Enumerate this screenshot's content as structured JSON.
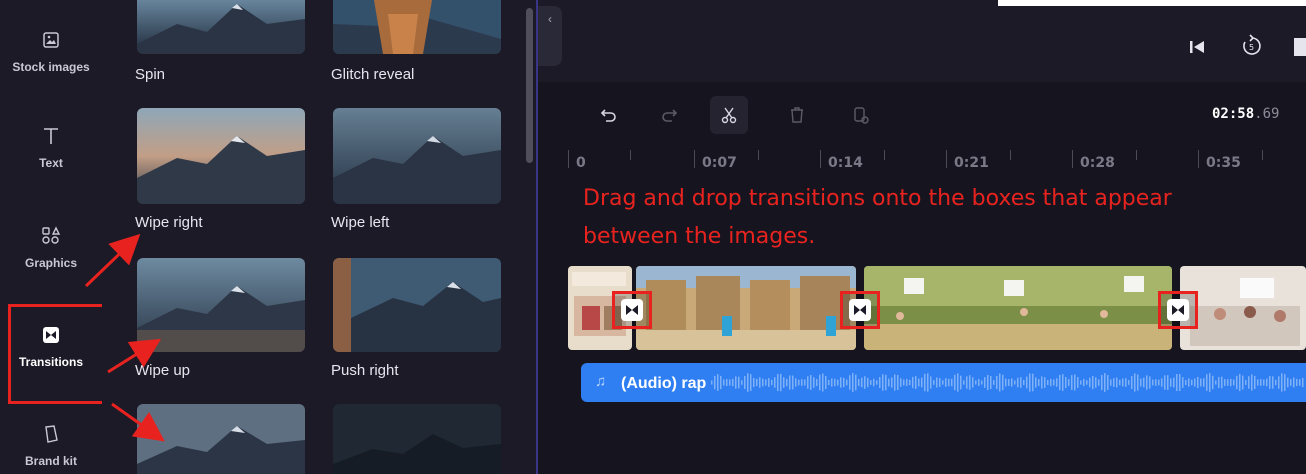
{
  "sidebar": {
    "items": [
      {
        "label": "Stock images",
        "icon": "image-icon"
      },
      {
        "label": "Text",
        "icon": "text-icon"
      },
      {
        "label": "Graphics",
        "icon": "shapes-icon"
      },
      {
        "label": "Transitions",
        "icon": "transitions-icon",
        "active": true
      },
      {
        "label": "Brand kit",
        "icon": "brand-kit-icon"
      }
    ]
  },
  "transitions_panel": {
    "items": [
      {
        "label": "Spin"
      },
      {
        "label": "Glitch reveal"
      },
      {
        "label": "Wipe right"
      },
      {
        "label": "Wipe left"
      },
      {
        "label": "Wipe up"
      },
      {
        "label": "Push right"
      }
    ]
  },
  "timeline": {
    "current_time": "02:58",
    "current_time_ms": ".69",
    "ruler": [
      "0",
      "0:07",
      "0:14",
      "0:21",
      "0:28",
      "0:35"
    ],
    "audio_track": {
      "label": "(Audio) rap"
    }
  },
  "annotation": {
    "line1": "Drag and drop transitions onto the boxes that appear",
    "line2": "between the images."
  },
  "colors": {
    "annotation_red": "#e8231f",
    "audio_blue": "#2f7ff2",
    "sidebar_bg": "#1b1a26",
    "timeline_bg": "#16151f"
  }
}
